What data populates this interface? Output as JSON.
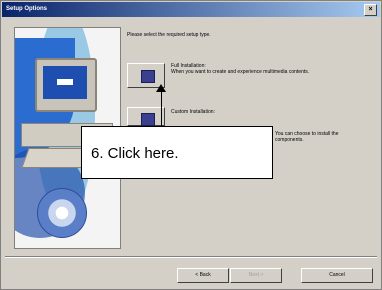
{
  "window": {
    "title": "Setup Options",
    "close_glyph": "×"
  },
  "prompt": "Please select the required setup type.",
  "options": [
    {
      "title": "Full Installation:",
      "desc": "When you want to create and experience multimedia contents."
    },
    {
      "title": "Custom Installation:",
      "desc": "You can choose to install the",
      "desc2": "components."
    }
  ],
  "callout": {
    "text": "6. Click here."
  },
  "buttons": {
    "back": "< Back",
    "next": "Next >",
    "cancel": "Cancel"
  }
}
